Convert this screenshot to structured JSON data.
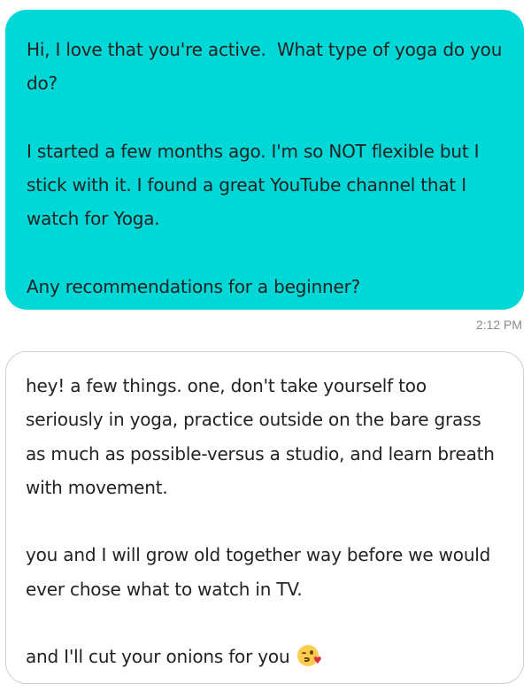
{
  "conversation": {
    "sent_message": {
      "paragraphs": [
        "Hi, I love that you're active.  What type of yoga do you do?",
        "I started a few months ago. I'm so NOT flexible but I stick with it. I found a great YouTube channel that I watch for Yoga.",
        "Any recommendations for a beginner?"
      ],
      "timestamp": "2:12 PM",
      "bubble_color": "#00d7d7"
    },
    "received_message": {
      "paragraphs": [
        "hey! a few things. one, don't take yourself too seriously in yoga, practice outside on the bare grass as much as possible-versus a studio, and learn breath with movement.",
        "you and I will grow old together way before we would ever chose what to watch in TV.",
        "and I'll cut your onions for you"
      ],
      "emoji": "face-blowing-a-kiss-icon",
      "bubble_color": "#ffffff"
    }
  }
}
